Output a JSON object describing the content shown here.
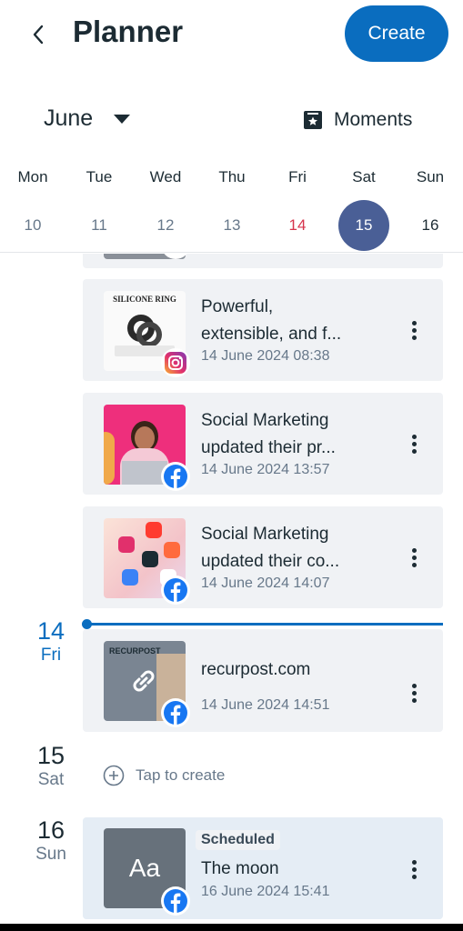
{
  "header": {
    "title": "Planner",
    "create_label": "Create"
  },
  "month_selector": {
    "month": "June",
    "moments_label": "Moments"
  },
  "week": [
    {
      "name": "Mon",
      "num": "10"
    },
    {
      "name": "Tue",
      "num": "11"
    },
    {
      "name": "Wed",
      "num": "12"
    },
    {
      "name": "Thu",
      "num": "13"
    },
    {
      "name": "Fri",
      "num": "14"
    },
    {
      "name": "Sat",
      "num": "15"
    },
    {
      "name": "Sun",
      "num": "16"
    }
  ],
  "colors": {
    "accent": "#0a6dbf",
    "selected_day": "#4a5f96",
    "weekend_red": "#d6344c"
  },
  "posts": [
    {
      "title_line1": "Powerful,",
      "title_line2": "extensible, and f...",
      "time": "14 June 2024 08:38",
      "network": "instagram-icon",
      "thumb_text": "SILICONE RING"
    },
    {
      "title_line1": "Social Marketing",
      "title_line2": "updated their pr...",
      "time": "14 June 2024 13:57",
      "network": "facebook-icon"
    },
    {
      "title_line1": "Social Marketing",
      "title_line2": "updated their co...",
      "time": "14 June 2024 14:07",
      "network": "facebook-icon"
    },
    {
      "title_line1": "recurpost.com",
      "time": "14 June 2024 14:51",
      "network": "facebook-icon",
      "thumb_text": "RECURPOST"
    },
    {
      "status": "Scheduled",
      "title_line1": "The moon",
      "time": "16 June 2024 15:41",
      "network": "facebook-icon",
      "thumb_text": "Aa"
    }
  ],
  "date_labels": [
    {
      "num": "14",
      "day": "Fri"
    },
    {
      "num": "15",
      "day": "Sat"
    },
    {
      "num": "16",
      "day": "Sun"
    }
  ],
  "tap_to_create": "Tap to create"
}
